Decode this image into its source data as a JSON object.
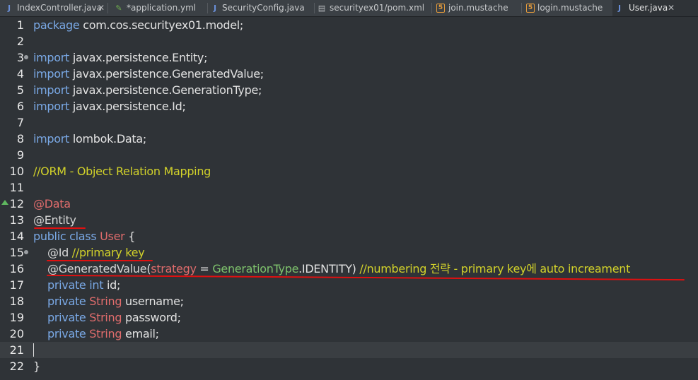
{
  "tabs": [
    {
      "label": "IndexController.java",
      "icon": "java-file-icon",
      "glyph": "J",
      "close": "✕"
    },
    {
      "label": "*application.yml",
      "icon": "yaml-leaf-icon",
      "glyph": "✎"
    },
    {
      "label": "SecurityConfig.java",
      "icon": "java-file-icon",
      "glyph": "J"
    },
    {
      "label": "securityex01/pom.xml",
      "icon": "xml-file-icon",
      "glyph": "▤"
    },
    {
      "label": "join.mustache",
      "icon": "html5-icon",
      "glyph": "5"
    },
    {
      "label": "login.mustache",
      "icon": "html5-icon",
      "glyph": "5"
    },
    {
      "label": "User.java",
      "icon": "java-file-icon",
      "glyph": "J",
      "close": "✕",
      "active": true
    }
  ],
  "colors": {
    "keyword": "#7aa9e6",
    "comment": "#d2d22a",
    "type": "#e06c6c",
    "annotation_mark": "#e01010"
  },
  "lines": {
    "n": [
      "1",
      "2",
      "3",
      "4",
      "5",
      "6",
      "7",
      "8",
      "9",
      "10",
      "11",
      "12",
      "13",
      "14",
      "15",
      "16",
      "17",
      "18",
      "19",
      "20",
      "21",
      "22"
    ],
    "l1": {
      "kw": "package",
      "rest": " com.cos.securityex01.model;"
    },
    "l3": {
      "kw": "import",
      "rest": " javax.persistence.Entity;"
    },
    "l4": {
      "kw": "import",
      "rest": " javax.persistence.GeneratedValue;"
    },
    "l5": {
      "kw": "import",
      "rest": " javax.persistence.GenerationType;"
    },
    "l6": {
      "kw": "import",
      "rest": " javax.persistence.Id;"
    },
    "l8": {
      "kw": "import",
      "rest": " lombok.Data;"
    },
    "l10": {
      "com": "//ORM - Object Relation Mapping"
    },
    "l12": {
      "ann": "@Data"
    },
    "l13": {
      "ann": "@Entity"
    },
    "l14": {
      "kw1": "public",
      "kw2": " class ",
      "cls": "User",
      "rest": " {"
    },
    "l15": {
      "ann": "@Id",
      "com": " //primary key"
    },
    "l16": {
      "ann": "@GeneratedValue",
      "p1": "(",
      "arg": "strategy",
      "eq": " = ",
      "cls": "GenerationType",
      "rest": ".IDENTITY)",
      "com": " //numbering 전략 - primary key에 auto increament"
    },
    "l17": {
      "kw": "private",
      "kw2": " int",
      "rest": " id;"
    },
    "l18": {
      "kw": "private",
      "ty": " String",
      "rest": " username;"
    },
    "l19": {
      "kw": "private",
      "ty": " String",
      "rest": " password;"
    },
    "l20": {
      "kw": "private",
      "ty": " String",
      "rest": " email;"
    },
    "l22": {
      "rest": "}"
    }
  }
}
